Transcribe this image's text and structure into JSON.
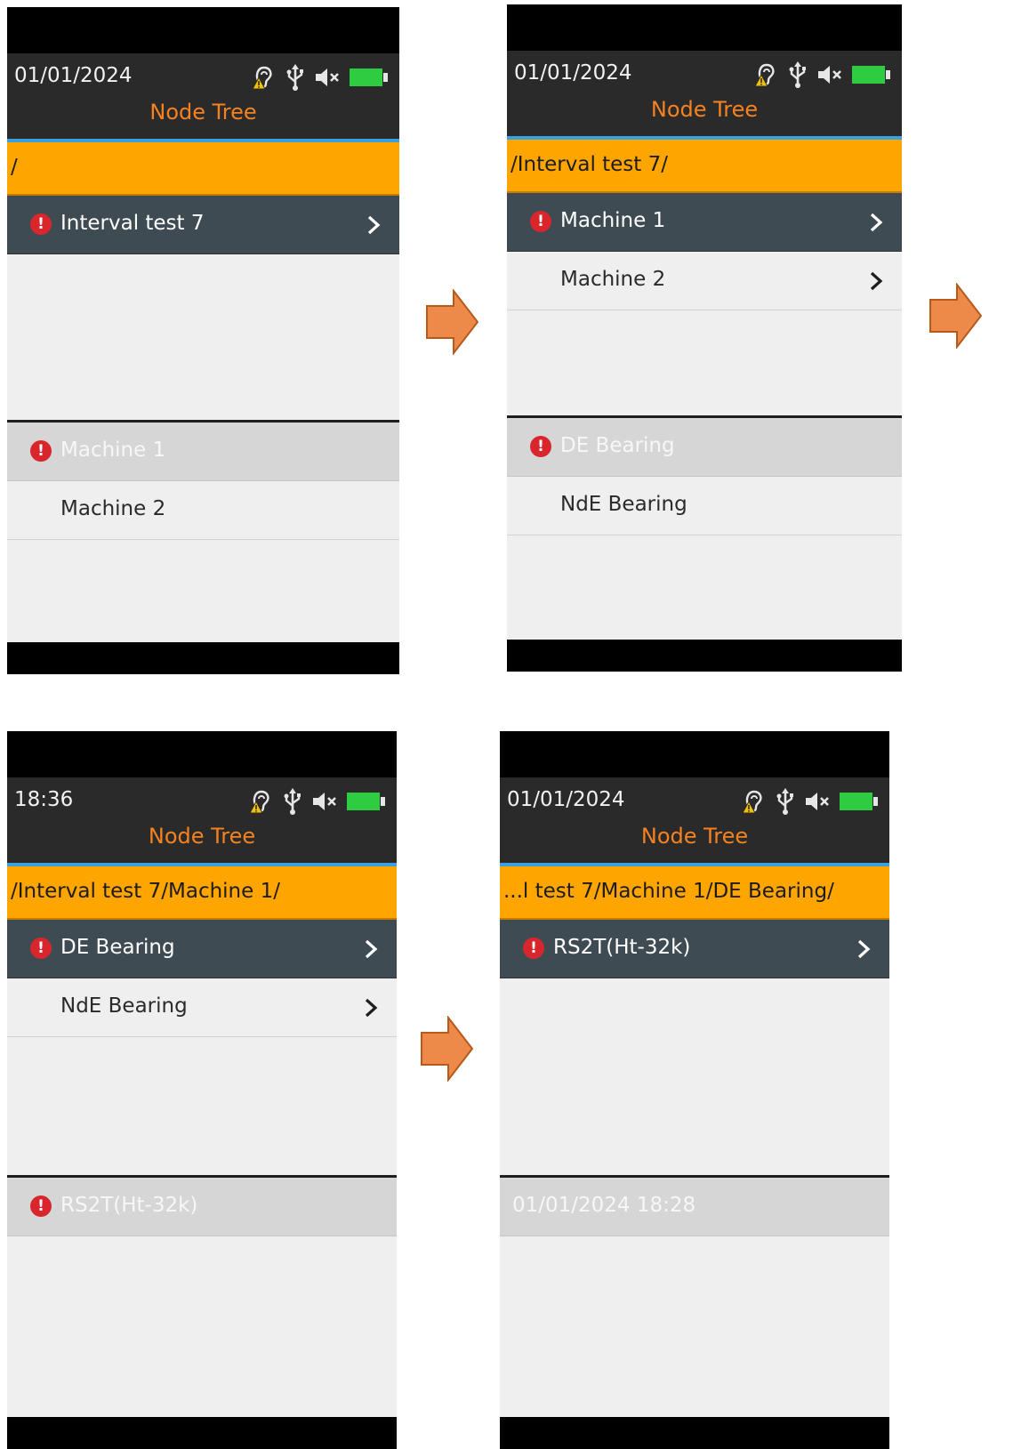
{
  "screens": [
    {
      "status_time": "01/01/2024",
      "title": "Node Tree",
      "path": "/",
      "list": [
        {
          "label": "Interval test 7",
          "alert": true,
          "selected": true,
          "chevron": true
        }
      ],
      "detail": [
        {
          "label": "Machine 1",
          "alert": true,
          "highlighted": true
        },
        {
          "label": "Machine 2",
          "alert": false,
          "highlighted": false
        }
      ]
    },
    {
      "status_time": "01/01/2024",
      "title": "Node Tree",
      "path": "/Interval test 7/",
      "list": [
        {
          "label": "Machine 1",
          "alert": true,
          "selected": true,
          "chevron": true
        },
        {
          "label": "Machine 2",
          "alert": false,
          "selected": false,
          "chevron": true
        }
      ],
      "detail": [
        {
          "label": "DE Bearing",
          "alert": true,
          "highlighted": true
        },
        {
          "label": "NdE Bearing",
          "alert": false,
          "highlighted": false
        }
      ]
    },
    {
      "status_time": "18:36",
      "title": "Node Tree",
      "path": "/Interval test 7/Machine 1/",
      "list": [
        {
          "label": "DE Bearing",
          "alert": true,
          "selected": true,
          "chevron": true
        },
        {
          "label": "NdE Bearing",
          "alert": false,
          "selected": false,
          "chevron": true
        }
      ],
      "detail": [
        {
          "label": "RS2T(Ht-32k)",
          "alert": true,
          "highlighted": true
        }
      ]
    },
    {
      "status_time": "01/01/2024",
      "title": "Node Tree",
      "path": "...l test 7/Machine 1/DE Bearing/",
      "list": [
        {
          "label": "RS2T(Ht-32k)",
          "alert": true,
          "selected": true,
          "chevron": true
        }
      ],
      "detail": [
        {
          "label": "01/01/2024 18:28",
          "alert": false,
          "highlighted": true
        }
      ]
    }
  ],
  "icons": {
    "status": [
      "hearing-warning-icon",
      "usb-icon",
      "speaker-mute-icon",
      "battery-icon"
    ],
    "row": [
      "alert-icon",
      "chevron-right-icon"
    ],
    "flow": "arrow-right-icon"
  },
  "colors": {
    "header_bg": "#2a2a2a",
    "title": "#f58220",
    "path_bar": "#ffa500",
    "selected_row": "#3f4b52",
    "highlight_row": "#d6d6d6",
    "alert": "#d9262c",
    "battery": "#2ecc40",
    "arrow": "#ed8a4a"
  }
}
